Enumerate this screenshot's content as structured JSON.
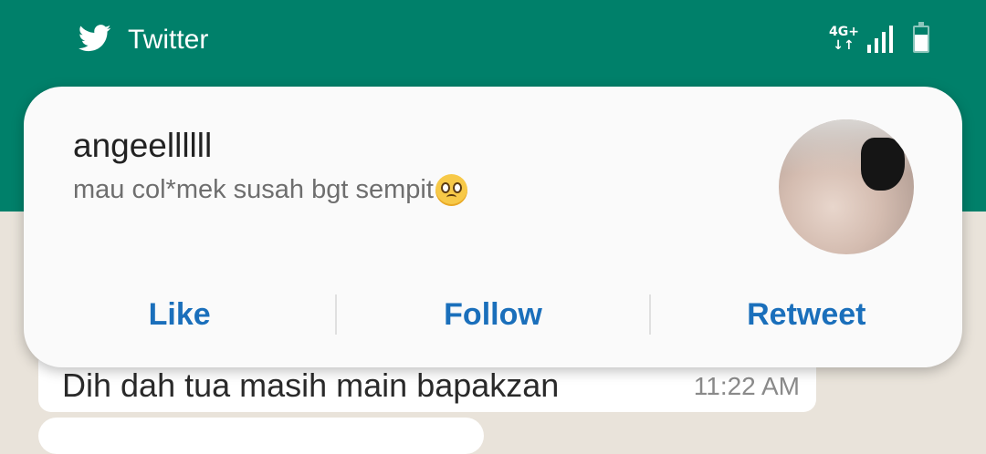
{
  "status_bar": {
    "app_name": "Twitter",
    "app_icon": "twitter-bird-icon",
    "network_type": "4G+",
    "signal_bars": 4,
    "battery_level": 0.7,
    "background_color": "#00806a"
  },
  "notification": {
    "sender": "angeellllll",
    "message": "mau col*mek susah bgt sempit",
    "message_emoji": "pleading-face-icon",
    "avatar": "profile-avatar",
    "actions": {
      "like": "Like",
      "follow": "Follow",
      "retweet": "Retweet"
    },
    "action_color": "#1a6fbb"
  },
  "background_chat": {
    "message_text": "Dih dah tua masih main bapakzan",
    "time": "11:22 AM"
  }
}
